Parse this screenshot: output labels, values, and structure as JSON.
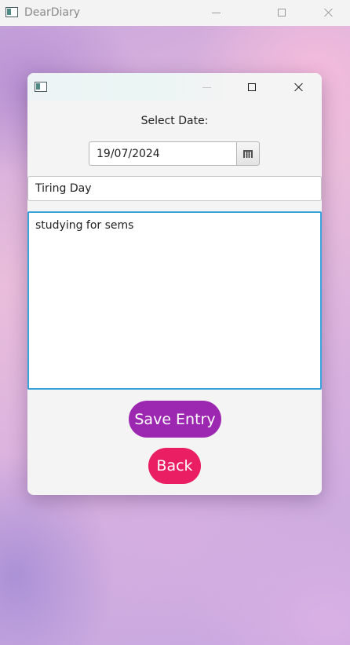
{
  "main_window": {
    "title": "DearDiary",
    "icon": "app-window-icon"
  },
  "dialog": {
    "icon": "app-window-icon",
    "date_label": "Select Date:",
    "date_value": "19/07/2024",
    "calendar_icon": "calendar-icon",
    "title_value": "Tiring Day",
    "body_value": "studying for sems",
    "save_label": "Save Entry",
    "back_label": "Back"
  },
  "colors": {
    "save_button": "#9c27b0",
    "back_button": "#e91e63",
    "focus_border": "#3aa3dc"
  }
}
